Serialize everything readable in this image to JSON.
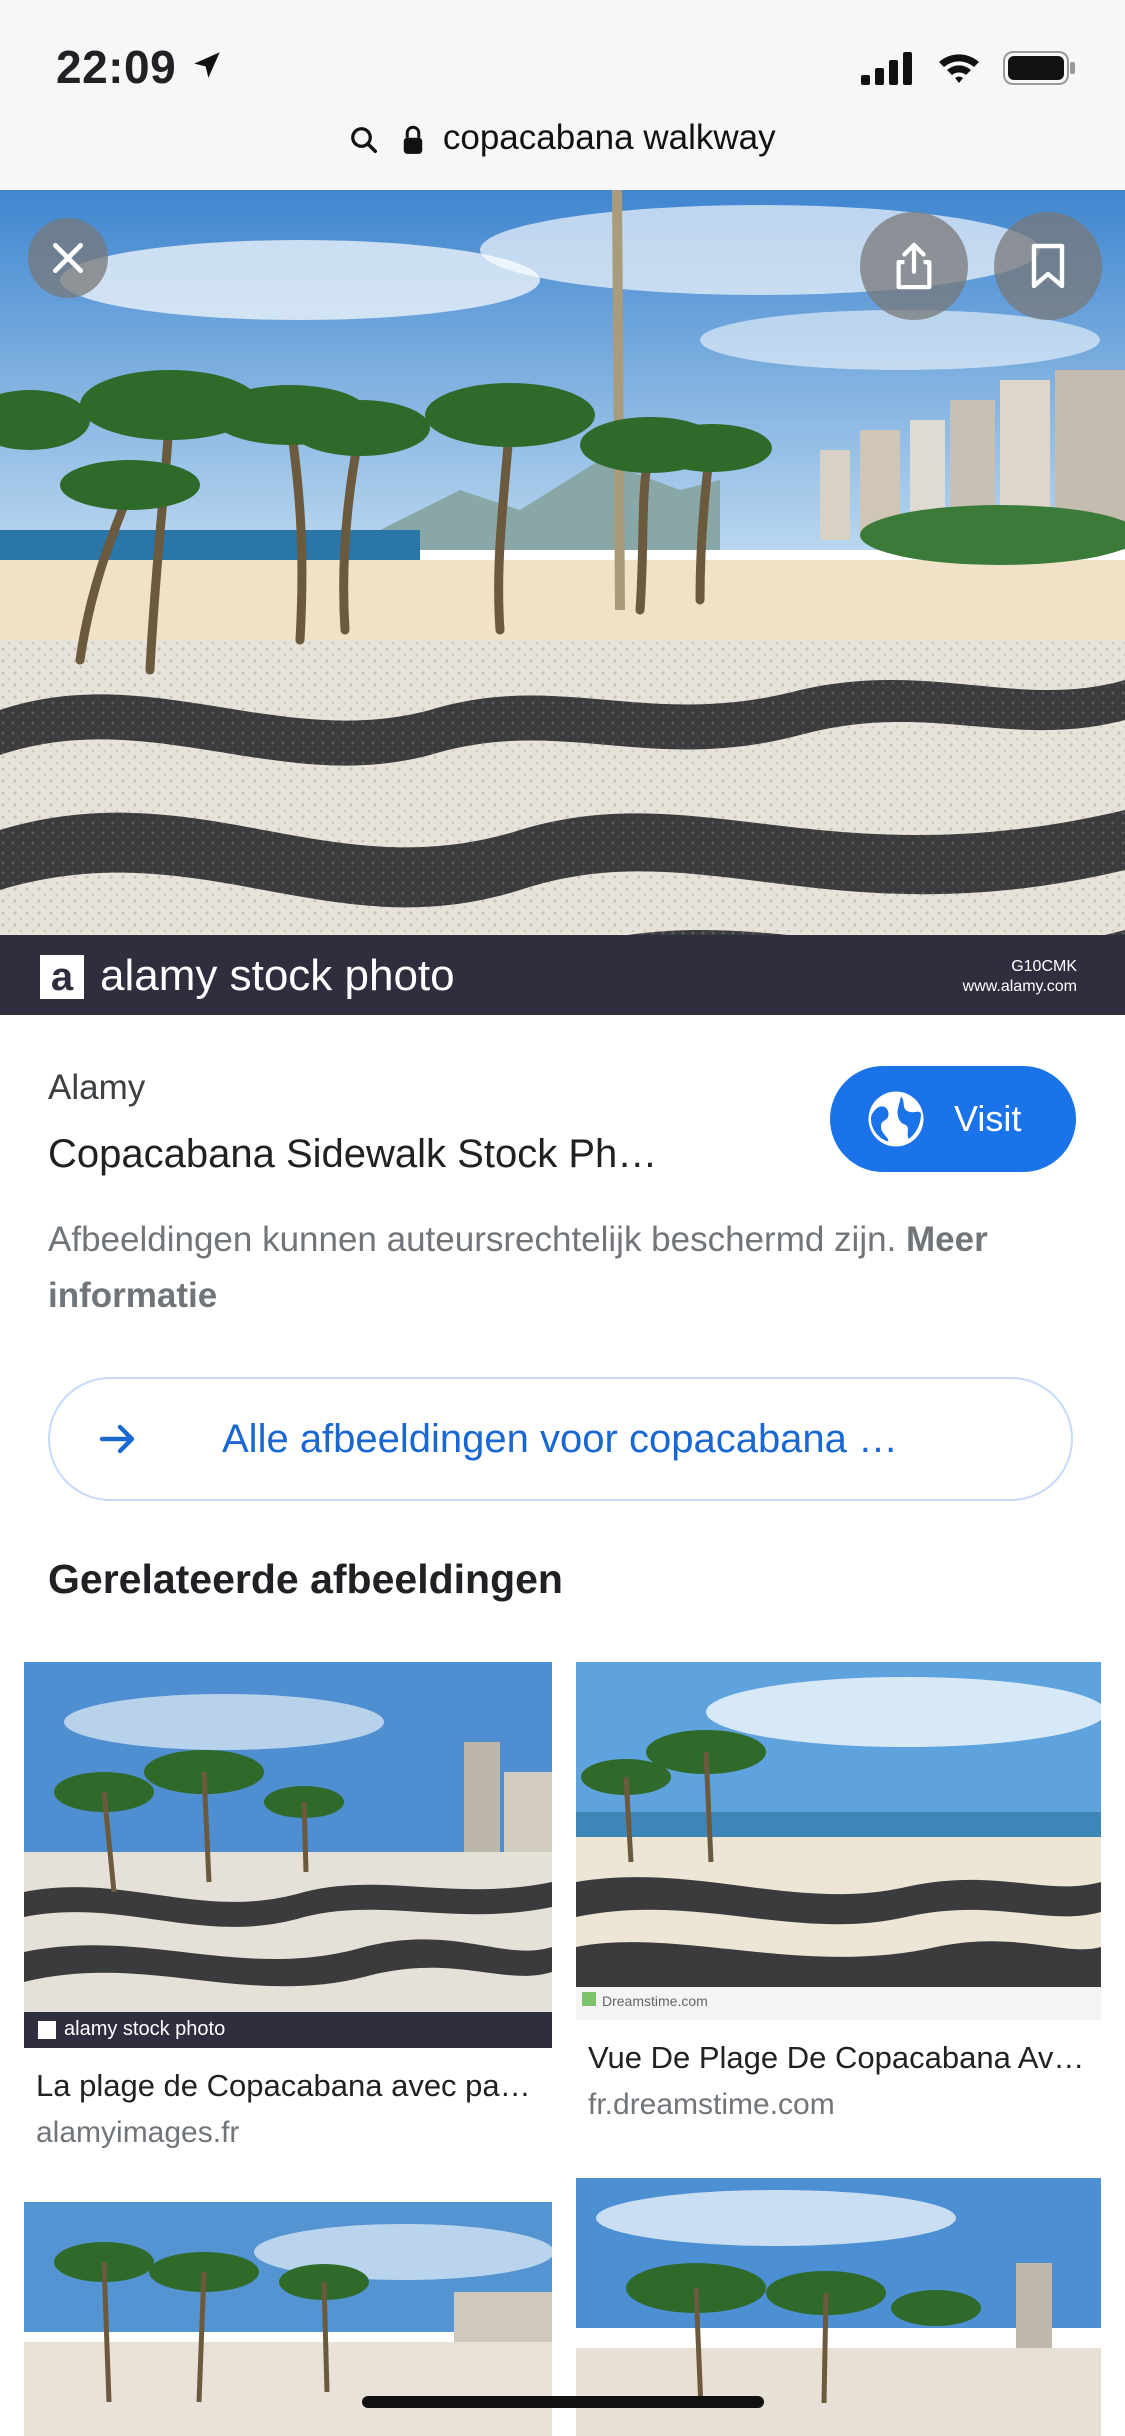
{
  "status_bar": {
    "time": "22:09"
  },
  "url_bar": {
    "query": "copacabana walkway"
  },
  "hero": {
    "watermark": "alamy stock photo",
    "image_code": "G10CMK",
    "image_site": "www.alamy.com"
  },
  "result": {
    "source": "Alamy",
    "title": "Copacabana Sidewalk Stock Ph…",
    "visit_label": "Visit",
    "notice": "Afbeeldingen kunnen auteursrechtelijk beschermd zijn.",
    "more_info": "Meer informatie"
  },
  "all_images_label": "Alle afbeeldingen voor copacabana …",
  "related": {
    "heading": "Gerelateerde afbeeldingen",
    "items": [
      {
        "title": "La plage de Copacabana avec pa…",
        "domain": "alamyimages.fr",
        "watermark": "alamy stock photo"
      },
      {
        "title": "Vue De Plage De Copacabana Av…",
        "domain": "fr.dreamstime.com",
        "watermark": "Dreamstime.com"
      }
    ]
  },
  "colors": {
    "accent": "#1a73e8",
    "caption_bar": "#2f2e3e"
  }
}
